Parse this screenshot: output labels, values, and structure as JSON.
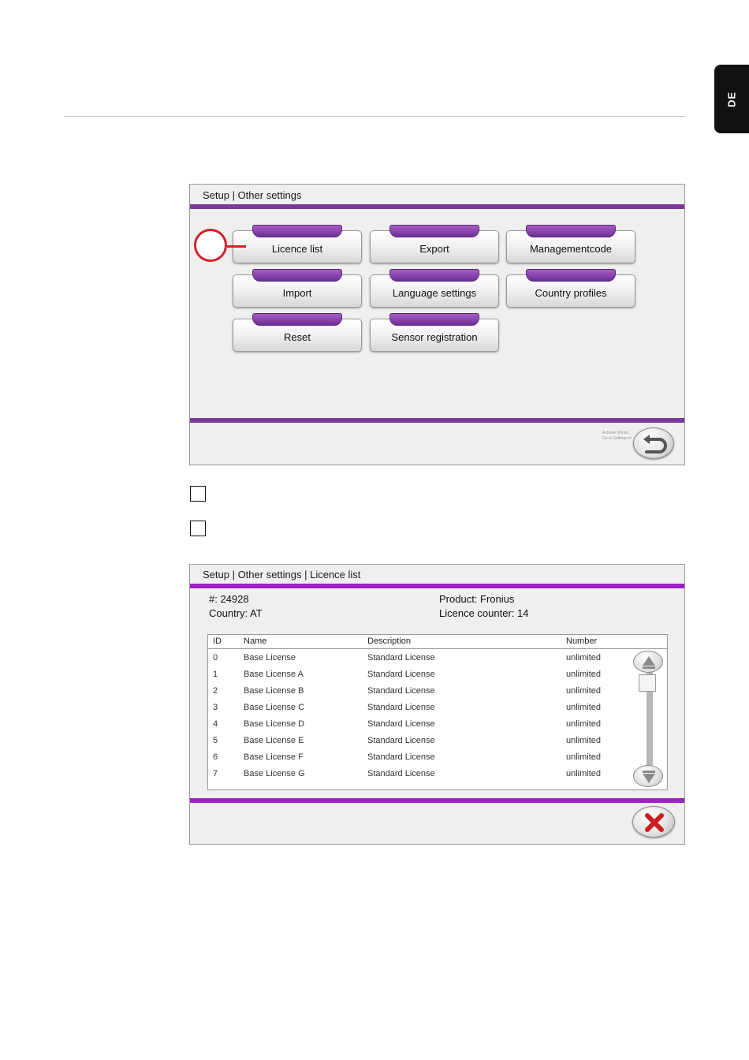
{
  "side_tab": {
    "label": "DE"
  },
  "screen1": {
    "title": "Setup | Other settings",
    "buttons": [
      "Licence list",
      "Export",
      "Managementcode",
      "Import",
      "Language settings",
      "Country profiles",
      "Reset",
      "Sensor registration"
    ],
    "watermark_line1": "Activate Windo",
    "watermark_line2": "Go to Settings to"
  },
  "screen2": {
    "title": "Setup | Other settings | Licence list",
    "serial": "#: 24928",
    "country": "Country: AT",
    "product": "Product: Fronius",
    "licence_counter": "Licence counter: 14",
    "columns": [
      "ID",
      "Name",
      "Description",
      "Number"
    ],
    "rows": [
      [
        "0",
        "Base License",
        "Standard License",
        "unlimited"
      ],
      [
        "1",
        "Base License A",
        "Standard License",
        "unlimited"
      ],
      [
        "2",
        "Base License B",
        "Standard License",
        "unlimited"
      ],
      [
        "3",
        "Base License C",
        "Standard License",
        "unlimited"
      ],
      [
        "4",
        "Base License D",
        "Standard License",
        "unlimited"
      ],
      [
        "5",
        "Base License E",
        "Standard License",
        "unlimited"
      ],
      [
        "6",
        "Base License F",
        "Standard License",
        "unlimited"
      ],
      [
        "7",
        "Base License G",
        "Standard License",
        "unlimited"
      ]
    ]
  },
  "colors": {
    "accent_purple": "#7b3a9a",
    "marker_red": "#d2232a",
    "close_red": "#cc1f1f"
  },
  "icons": {
    "back": "back-arrow-icon",
    "close": "close-x-icon",
    "scroll_up": "triangle-up-icon",
    "scroll_down": "triangle-down-icon"
  }
}
